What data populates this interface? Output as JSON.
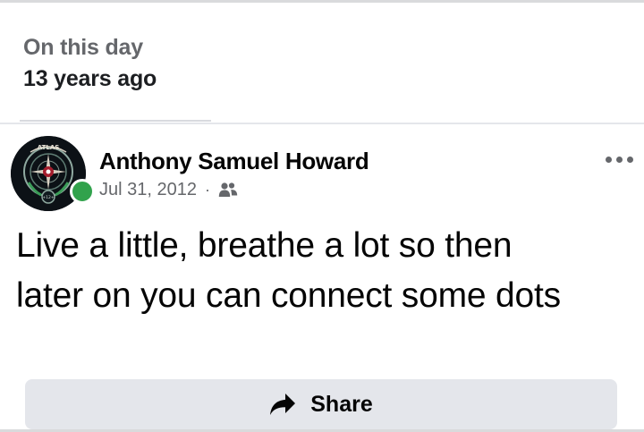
{
  "memory": {
    "title": "On this day",
    "subtitle": "13 years ago"
  },
  "post": {
    "author": "Anthony Samuel Howard",
    "date": "Jul 31, 2012",
    "separator": "·",
    "audience_icon": "friends-icon",
    "online_status_color": "#31a24c",
    "text_line_1": "Live a little, breathe a lot so then",
    "text_line_2": "later on you can connect some dots",
    "more_icon": "more-options-icon",
    "avatar_logo_text": "ATLAS",
    "avatar_badge_text": "+12+"
  },
  "actions": {
    "share_label": "Share",
    "share_icon": "share-arrow-icon"
  }
}
